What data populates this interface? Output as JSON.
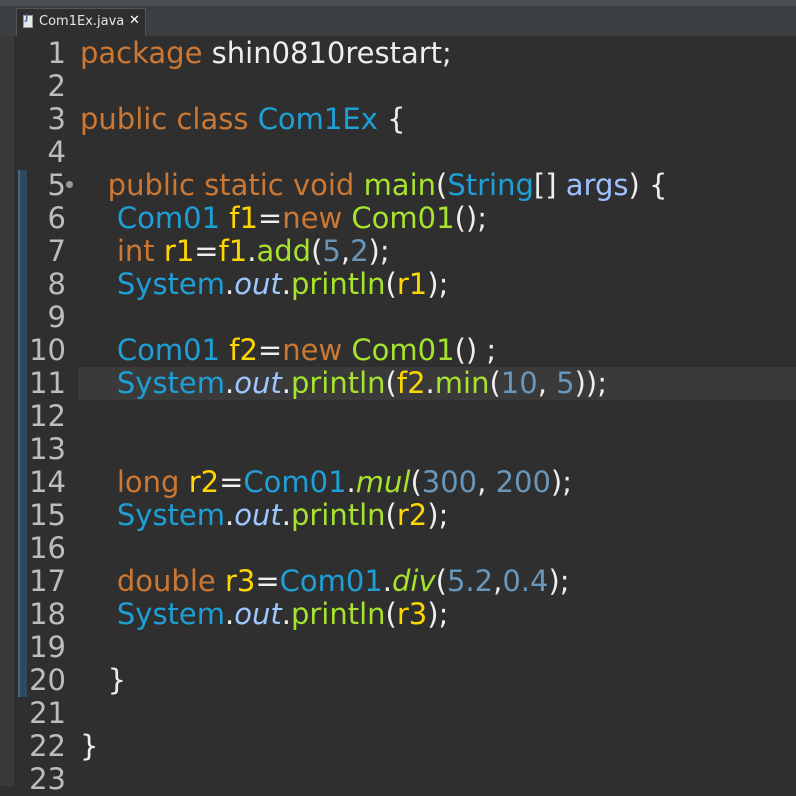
{
  "tab": {
    "filename": "Com1Ex.java",
    "close_glyph": "✕",
    "icon": "java-file-icon"
  },
  "editor": {
    "current_line": 11,
    "lines": [
      {
        "n": "1",
        "tokens": [
          [
            "kw",
            "package "
          ],
          [
            "plain",
            "shin0810restart;"
          ]
        ]
      },
      {
        "n": "2",
        "tokens": []
      },
      {
        "n": "3",
        "tokens": [
          [
            "kw",
            "public class "
          ],
          [
            "cls",
            "Com1Ex"
          ],
          [
            "plain",
            " {"
          ]
        ]
      },
      {
        "n": "4",
        "tokens": []
      },
      {
        "n": "5",
        "tokens": [
          [
            "plain",
            "   "
          ],
          [
            "kw",
            "public static void "
          ],
          [
            "meth",
            "main"
          ],
          [
            "plain",
            "("
          ],
          [
            "cls",
            "String"
          ],
          [
            "plain",
            "[] "
          ],
          [
            "param",
            "args"
          ],
          [
            "plain",
            ") {"
          ]
        ]
      },
      {
        "n": "6",
        "tokens": [
          [
            "plain",
            "    "
          ],
          [
            "cls",
            "Com01 "
          ],
          [
            "var",
            "f1"
          ],
          [
            "plain",
            "="
          ],
          [
            "kw",
            "new "
          ],
          [
            "meth",
            "Com01"
          ],
          [
            "plain",
            "();"
          ]
        ]
      },
      {
        "n": "7",
        "tokens": [
          [
            "plain",
            "    "
          ],
          [
            "kw",
            "int "
          ],
          [
            "var",
            "r1"
          ],
          [
            "plain",
            "="
          ],
          [
            "var",
            "f1"
          ],
          [
            "plain",
            "."
          ],
          [
            "meth",
            "add"
          ],
          [
            "plain",
            "("
          ],
          [
            "num",
            "5"
          ],
          [
            "plain",
            ","
          ],
          [
            "num",
            "2"
          ],
          [
            "plain",
            ");"
          ]
        ]
      },
      {
        "n": "8",
        "tokens": [
          [
            "plain",
            "    "
          ],
          [
            "cls",
            "System"
          ],
          [
            "plain",
            "."
          ],
          [
            "field",
            "out"
          ],
          [
            "plain",
            "."
          ],
          [
            "meth",
            "println"
          ],
          [
            "plain",
            "("
          ],
          [
            "var",
            "r1"
          ],
          [
            "plain",
            ");"
          ]
        ]
      },
      {
        "n": "9",
        "tokens": []
      },
      {
        "n": "10",
        "tokens": [
          [
            "plain",
            "    "
          ],
          [
            "cls",
            "Com01 "
          ],
          [
            "var",
            "f2"
          ],
          [
            "plain",
            "="
          ],
          [
            "kw",
            "new "
          ],
          [
            "meth",
            "Com01"
          ],
          [
            "plain",
            "() ;"
          ]
        ]
      },
      {
        "n": "11",
        "tokens": [
          [
            "plain",
            "    "
          ],
          [
            "cls",
            "System"
          ],
          [
            "plain",
            "."
          ],
          [
            "field",
            "out"
          ],
          [
            "plain",
            "."
          ],
          [
            "meth",
            "println"
          ],
          [
            "plain",
            "("
          ],
          [
            "var",
            "f2"
          ],
          [
            "plain",
            "."
          ],
          [
            "meth",
            "min"
          ],
          [
            "plain",
            "("
          ],
          [
            "num",
            "10"
          ],
          [
            "plain",
            ", "
          ],
          [
            "num",
            "5"
          ],
          [
            "plain",
            "));"
          ]
        ]
      },
      {
        "n": "12",
        "tokens": []
      },
      {
        "n": "13",
        "tokens": []
      },
      {
        "n": "14",
        "tokens": [
          [
            "plain",
            "    "
          ],
          [
            "kw",
            "long "
          ],
          [
            "var",
            "r2"
          ],
          [
            "plain",
            "="
          ],
          [
            "cls",
            "Com01"
          ],
          [
            "plain",
            "."
          ],
          [
            "smeth",
            "mul"
          ],
          [
            "plain",
            "("
          ],
          [
            "num",
            "300"
          ],
          [
            "plain",
            ", "
          ],
          [
            "num",
            "200"
          ],
          [
            "plain",
            ");"
          ]
        ]
      },
      {
        "n": "15",
        "tokens": [
          [
            "plain",
            "    "
          ],
          [
            "cls",
            "System"
          ],
          [
            "plain",
            "."
          ],
          [
            "field",
            "out"
          ],
          [
            "plain",
            "."
          ],
          [
            "meth",
            "println"
          ],
          [
            "plain",
            "("
          ],
          [
            "var",
            "r2"
          ],
          [
            "plain",
            ");"
          ]
        ]
      },
      {
        "n": "16",
        "tokens": []
      },
      {
        "n": "17",
        "tokens": [
          [
            "plain",
            "    "
          ],
          [
            "kw",
            "double "
          ],
          [
            "var",
            "r3"
          ],
          [
            "plain",
            "="
          ],
          [
            "cls",
            "Com01"
          ],
          [
            "plain",
            "."
          ],
          [
            "smeth",
            "div"
          ],
          [
            "plain",
            "("
          ],
          [
            "num",
            "5.2"
          ],
          [
            "plain",
            ","
          ],
          [
            "num",
            "0.4"
          ],
          [
            "plain",
            ");"
          ]
        ]
      },
      {
        "n": "18",
        "tokens": [
          [
            "plain",
            "    "
          ],
          [
            "cls",
            "System"
          ],
          [
            "plain",
            "."
          ],
          [
            "field",
            "out"
          ],
          [
            "plain",
            "."
          ],
          [
            "meth",
            "println"
          ],
          [
            "plain",
            "("
          ],
          [
            "var",
            "r3"
          ],
          [
            "plain",
            ");"
          ]
        ]
      },
      {
        "n": "19",
        "tokens": []
      },
      {
        "n": "20",
        "tokens": [
          [
            "plain",
            "   }"
          ]
        ]
      },
      {
        "n": "21",
        "tokens": []
      },
      {
        "n": "22",
        "tokens": [
          [
            "plain",
            "}"
          ]
        ]
      },
      {
        "n": "23",
        "tokens": []
      }
    ]
  }
}
